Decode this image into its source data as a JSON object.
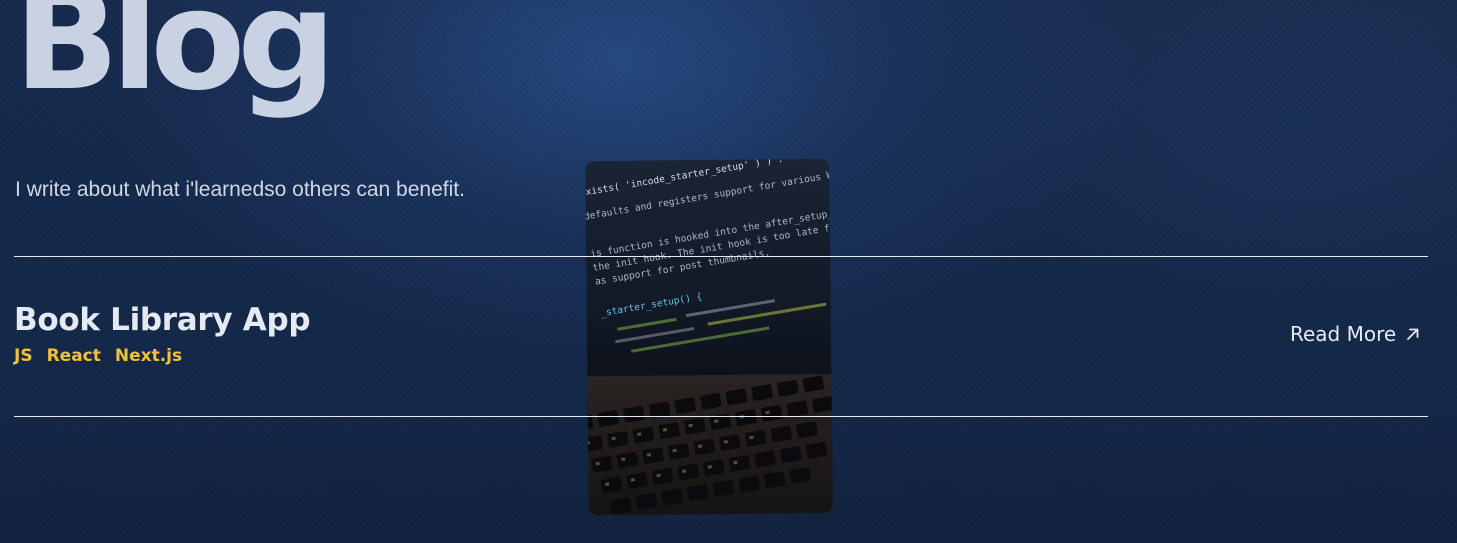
{
  "header": {
    "title": "Blog",
    "subtitle": "I write about what i'learnedso others can benefit."
  },
  "post": {
    "title": "Book Library App",
    "tags": [
      "JS",
      "React",
      "Next.js"
    ],
    "read_more_label": "Read More",
    "read_more_icon": "arrow-up-right-icon"
  },
  "preview": {
    "code_lines": [
      "exists( 'incode_starter_setup' ) ) :",
      "defaults and registers support for various W",
      "",
      "is function is hooked into the after_setup_theme",
      "the init hook. The init hook is too late for some",
      "as support for post thumbnails.",
      "",
      "_starter_setup() {"
    ]
  },
  "colors": {
    "accent_tag": "#f0c23a",
    "background": "#14284a",
    "title": "#c9d2e2",
    "divider": "#e6ebf3"
  }
}
